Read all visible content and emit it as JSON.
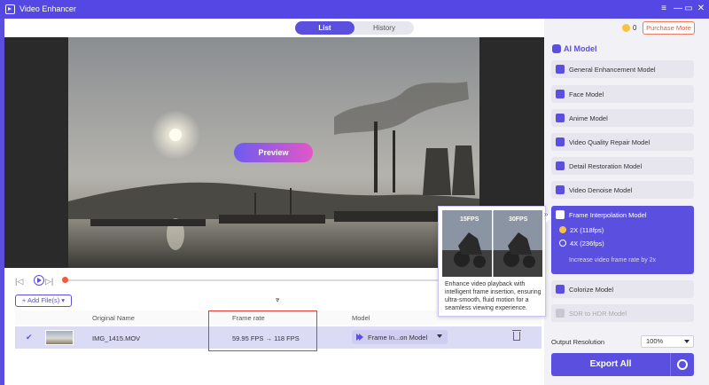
{
  "window": {
    "title": "Video Enhancer",
    "minimize": "—",
    "maximize": "▭",
    "close": "✕"
  },
  "tabs": [
    {
      "label": "List"
    },
    {
      "label": "History"
    }
  ],
  "credits": "0",
  "purchase_label": "Purchase More",
  "preview": {
    "button_label": "Preview"
  },
  "player": {
    "prev": "|◁",
    "next": "▷|",
    "progress_fraction": 0.0
  },
  "add_files_label": "+ Add File(s) ▾",
  "collapse_glyph": "⩔",
  "table": {
    "headers": {
      "name": "Original Name",
      "frame_rate": "Frame rate",
      "model": "Model"
    },
    "rows": [
      {
        "check": "✔",
        "name": "IMG_1415.MOV",
        "frame_rate": "59.95 FPS → 118 FPS",
        "model": "Frame In...on Model"
      }
    ]
  },
  "tooltip": {
    "left_label": "15FPS",
    "right_label": "30FPS",
    "description": "Enhance video playback with intelligent frame insertion, ensuring ultra-smooth, fluid motion for a seamless viewing experience.",
    "chevron": "»"
  },
  "sidebar": {
    "title": "AI Model",
    "models": [
      {
        "label": "General Enhancement Model",
        "icon": "image-enhance-icon"
      },
      {
        "label": "Face Model",
        "icon": "face-icon"
      },
      {
        "label": "Anime Model",
        "icon": "anime-icon"
      },
      {
        "label": "Video Quality Repair Model",
        "icon": "repair-icon"
      },
      {
        "label": "Detail Restoration Model",
        "icon": "detail-icon"
      },
      {
        "label": "Video Denoise Model",
        "icon": "denoise-icon"
      }
    ],
    "selected_model": {
      "label": "Frame Interpolation Model",
      "options": [
        {
          "label": "2X (118fps)",
          "selected": true
        },
        {
          "label": "4X (236fps)",
          "selected": false
        }
      ],
      "hint": "Increase video frame rate by 2x"
    },
    "models_after": [
      {
        "label": "Colorize Model",
        "icon": "colorize-icon",
        "disabled": false
      },
      {
        "label": "SDR to HDR Model",
        "icon": "hdr-icon",
        "disabled": true
      }
    ],
    "output_resolution_label": "Output Resolution",
    "output_resolution_value": "100%",
    "export_label": "Export All"
  },
  "colors": {
    "accent": "#5b4fe0",
    "highlight_box": "#e53935",
    "purchase": "#e8593a"
  }
}
